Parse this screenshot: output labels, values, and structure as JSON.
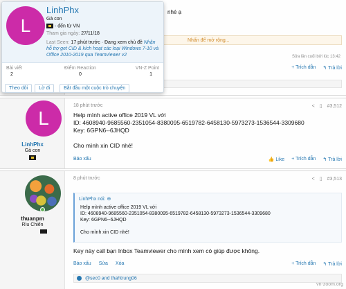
{
  "popup": {
    "name": "LinhPhx",
    "title": "Gà con",
    "location": "- đến từ VN",
    "joined_label": "Tham gia ngày:",
    "joined_value": "27/11/18",
    "last_seen_label": "Last Seen:",
    "last_seen_value": "17 phút trước · Đang xem chủ đề",
    "last_seen_topic": "Nhận hỗ trợ get CID & kích hoạt các loại Windows 7-10 và Office 2010-2019 qua Teamviewer v2",
    "stats": [
      {
        "label": "Bài viết",
        "value": "2"
      },
      {
        "label": "Điểm Reaction",
        "value": "0"
      },
      {
        "label": "VN-Z Point",
        "value": "1"
      }
    ],
    "buttons": [
      "Theo dõi",
      "Lờ đi",
      "Bắt đầu một cuộc trò chuyện"
    ]
  },
  "post0": {
    "body_tail": "nhé ạ",
    "quote_hint": "Nhấn để mở rộng...",
    "edited": "Sửa lần cuối bởi",
    "edited_time": "lúc 13:42",
    "reply_quote": "+ Trích dẫn",
    "reply": "↰ Trả lời"
  },
  "post1": {
    "author": "LinhPhx",
    "author_title": "Gà con",
    "time": "18 phút trước",
    "number": "#3,512",
    "body": [
      "Help mình active office 2019 VL với",
      "ID: 4608940-9685560-2351054-8380095-6519782-6458130-5973273-1536544-3309680",
      "Key: 6GPN6--6JHQD",
      "",
      "Cho mình xin CID nhé!"
    ],
    "report": "Báo xấu",
    "like": "Like",
    "reply_quote": "+ Trích dẫn",
    "reply": "↰ Trả lời"
  },
  "post2": {
    "author": "thuanpm",
    "author_title": "Rìu Chiến",
    "time": "8 phút trước",
    "number": "#3,513",
    "quote_author": "LinhPhx nói:",
    "quote_lines": [
      "Help mình active office 2019 VL với",
      "ID: 4608940-9685560-2351054-8380095-6519782-6458130-5973273-1536544-3309680",
      "Key: 6GPN6--6JHQD",
      "",
      "Cho mình xin CID nhé!"
    ],
    "body": "Key này call bạn Inbox Teamviewer cho mình xem có giúp được không.",
    "report": "Báo xấu",
    "edit": "Sửa",
    "delete": "Xóa",
    "reply_quote": "+ Trích dẫn",
    "reply": "↰ Trả lời",
    "reactors": "@sec0 and thahtrung06"
  },
  "watermark": "vn-zoom.org",
  "colors": {
    "accent": "#2577b1",
    "avatar": "#cc2ba8",
    "quote_bar": "#6aa1d8"
  }
}
